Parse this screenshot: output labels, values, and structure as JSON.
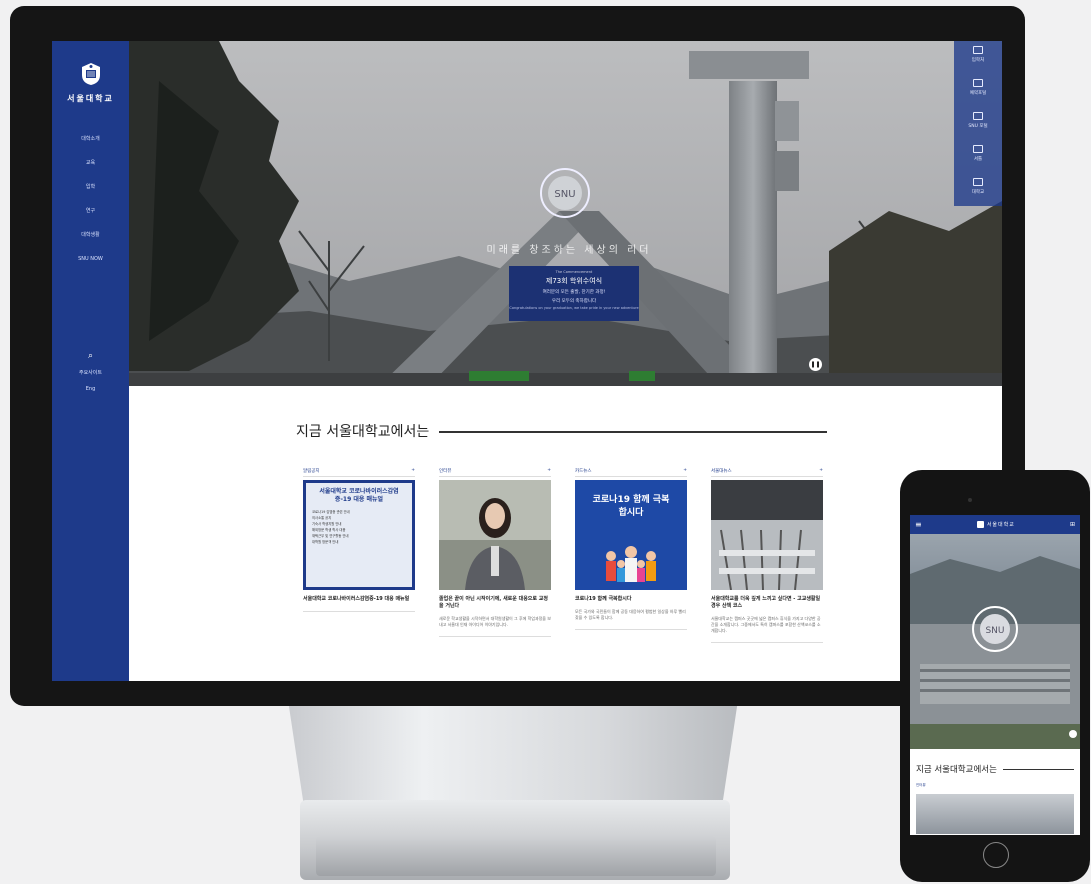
{
  "desktop": {
    "logo_text": "서울대학교",
    "nav": [
      "대학소개",
      "교육",
      "입학",
      "연구",
      "대학생활",
      "SNU NOW"
    ],
    "tools": [
      "주요사이트",
      "Eng"
    ],
    "quick_links": [
      "입학처",
      "예약포털",
      "SNU 포털",
      "셔틀",
      "대학교"
    ],
    "hero": {
      "tagline": "미래를 창조하는 세상의 리더",
      "banner_small": "The Commencement",
      "banner_title": "제73회 학위수여식",
      "banner_line1": "여러분의 모든 출발, 찬기한 과정!",
      "banner_line2": "우리 모두의 축하합니다",
      "banner_eng": "Congratulations on your graduation, we take pride in your new adventure"
    },
    "section_title": "지금 서울대학교에서는",
    "cards": [
      {
        "category": "알림공지",
        "image_title": "서울대학교 코로나바이러스감염증-19 대응 매뉴얼",
        "image_items": [
          "코로나19 감염증 관련 안내",
          "의사소통 공지",
          "기숙사 학생지원 안내",
          "해외방문 학생 학사 대응",
          "재택근무 및 연구활동 안내",
          "대학원 방문객 안내"
        ],
        "title": "서울대학교 코로나바이러스감염증-19 대응 매뉴얼",
        "desc": ""
      },
      {
        "category": "인터뷰",
        "image_title": "",
        "image_items": [],
        "title": "졸업은 끝이 아닌 시작이기에, 새로운 대응으로 교정을 거닌다",
        "desc": "새로운 학교생활을 시작하면서 대학원생활이 그 후에 학업과정을 보내고 서울대 인재 아이디어 이야기입니다."
      },
      {
        "category": "카드뉴스",
        "image_title": "코로나19 함께 극복합시다",
        "image_items": [],
        "title": "코로나19 함께 극복합시다",
        "desc": "모든 국가와 국민들이 함께 공동 대응하여 평범한 일상을 하루 빨리 찾을 수 있도록 합니다."
      },
      {
        "category": "서울대뉴스",
        "image_title": "",
        "image_items": [],
        "title": "서울대학교를 더욱 깊게 느끼고 싶다면 - 고교생활일 경우 산책 코스",
        "desc": "서울대학교는 캠퍼스 곳곳에 넓은 캠퍼스 휴식을 가지고 다양한 공간을 소개합니다. 그중에서도 특히 캠퍼스를 포함한 산책코스를 소개합니다."
      }
    ]
  },
  "mobile": {
    "logo_text": "서울대학교",
    "section_title": "지금 서울대학교에서는",
    "first_category": "인터뷰"
  },
  "colors": {
    "brand_blue": "#1e3a8a",
    "card_news_blue": "#1e49a6"
  }
}
